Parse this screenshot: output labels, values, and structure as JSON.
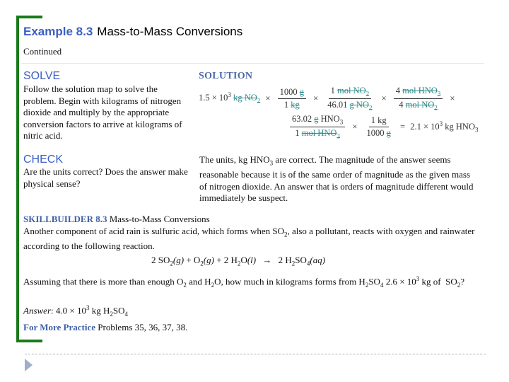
{
  "header": {
    "example_number": "Example 8.3",
    "title": "Mass-to-Mass Conversions",
    "subtitle": "Continued"
  },
  "solve": {
    "heading": "SOLVE",
    "text": "Follow the solution map to solve the problem. Begin with kilograms of nitrogen dioxide and multiply by the appropriate conversion factors to arrive at kilograms of nitric acid."
  },
  "solution": {
    "heading": "SOLUTION",
    "start_quantity": "1.5 × 10",
    "start_exp": "3",
    "start_unit_kg": "kg",
    "start_unit_species": "NO",
    "start_unit_sub": "2",
    "times": "×",
    "equals": "=",
    "factors": [
      {
        "num": "1000 g",
        "den": "1 kg"
      },
      {
        "num": "1 mol NO₂",
        "den": "46.01 g NO₂"
      },
      {
        "num": "4 mol HNO₃",
        "den": "4 mol NO₂"
      },
      {
        "num": "63.02 g HNO₃",
        "den": "1 mol HNO₃"
      },
      {
        "num": "1 kg",
        "den": "1000 g"
      }
    ],
    "result_value": "2.1 × 10",
    "result_exp": "3",
    "result_unit": "kg HNO",
    "result_sub": "3"
  },
  "check": {
    "heading": "CHECK",
    "question": "Are the units correct? Does the answer make physical sense?",
    "answer_pre": "The units, kg HNO",
    "answer_sub": "3",
    "answer_post": " are correct. The magnitude of the answer seems reasonable because it is of the same order of magnitude as the given mass of nitrogen dioxide. An answer that is orders of magnitude different would immediately be suspect."
  },
  "skillbuilder": {
    "label": "SKILLBUILDER 8.3",
    "title": " Mass-to-Mass Conversions",
    "text_pre": "Another component of acid rain is sulfuric acid, which forms when SO",
    "text_sub": "2",
    "text_post": ", also a pollutant, reacts with oxygen and rainwater according to the following reaction.",
    "equation": {
      "reactant1_coef": "2 SO",
      "reactant1_sub": "2",
      "reactant1_state": "(g)",
      "plus1": " + ",
      "reactant2": "O",
      "reactant2_sub": "2",
      "reactant2_state": "(g)",
      "plus2": " + ",
      "reactant3_coef": "2 H",
      "reactant3_sub": "2",
      "reactant3_rest": "O",
      "reactant3_state": "(l)",
      "arrow": "→",
      "product_coef": "2 H",
      "product_sub1": "2",
      "product_mid": "SO",
      "product_sub2": "4",
      "product_state": "(aq)"
    },
    "question_parts": [
      "Assuming that there is more than enough O",
      "2",
      " and H",
      "2",
      "O, how much in kilograms forms from H",
      "2",
      "SO",
      "4",
      " 2.6 × 10",
      "3",
      " kg of  SO",
      "2",
      "?"
    ],
    "answer_label": "Answer",
    "answer_parts": [
      ": 4.0 × 10",
      "3",
      " kg H",
      "2",
      "SO",
      "4"
    ],
    "more_label": "For More Practice",
    "more_text": " Problems 35, 36, 37, 38."
  },
  "nav": {
    "next_icon": "play-triangle-icon"
  },
  "colors": {
    "accent_blue": "#3a5fc4",
    "bracket_green": "#1a7a1a",
    "cancel_teal": "#2d8c8c",
    "nav_triangle": "#9fb0c8"
  }
}
